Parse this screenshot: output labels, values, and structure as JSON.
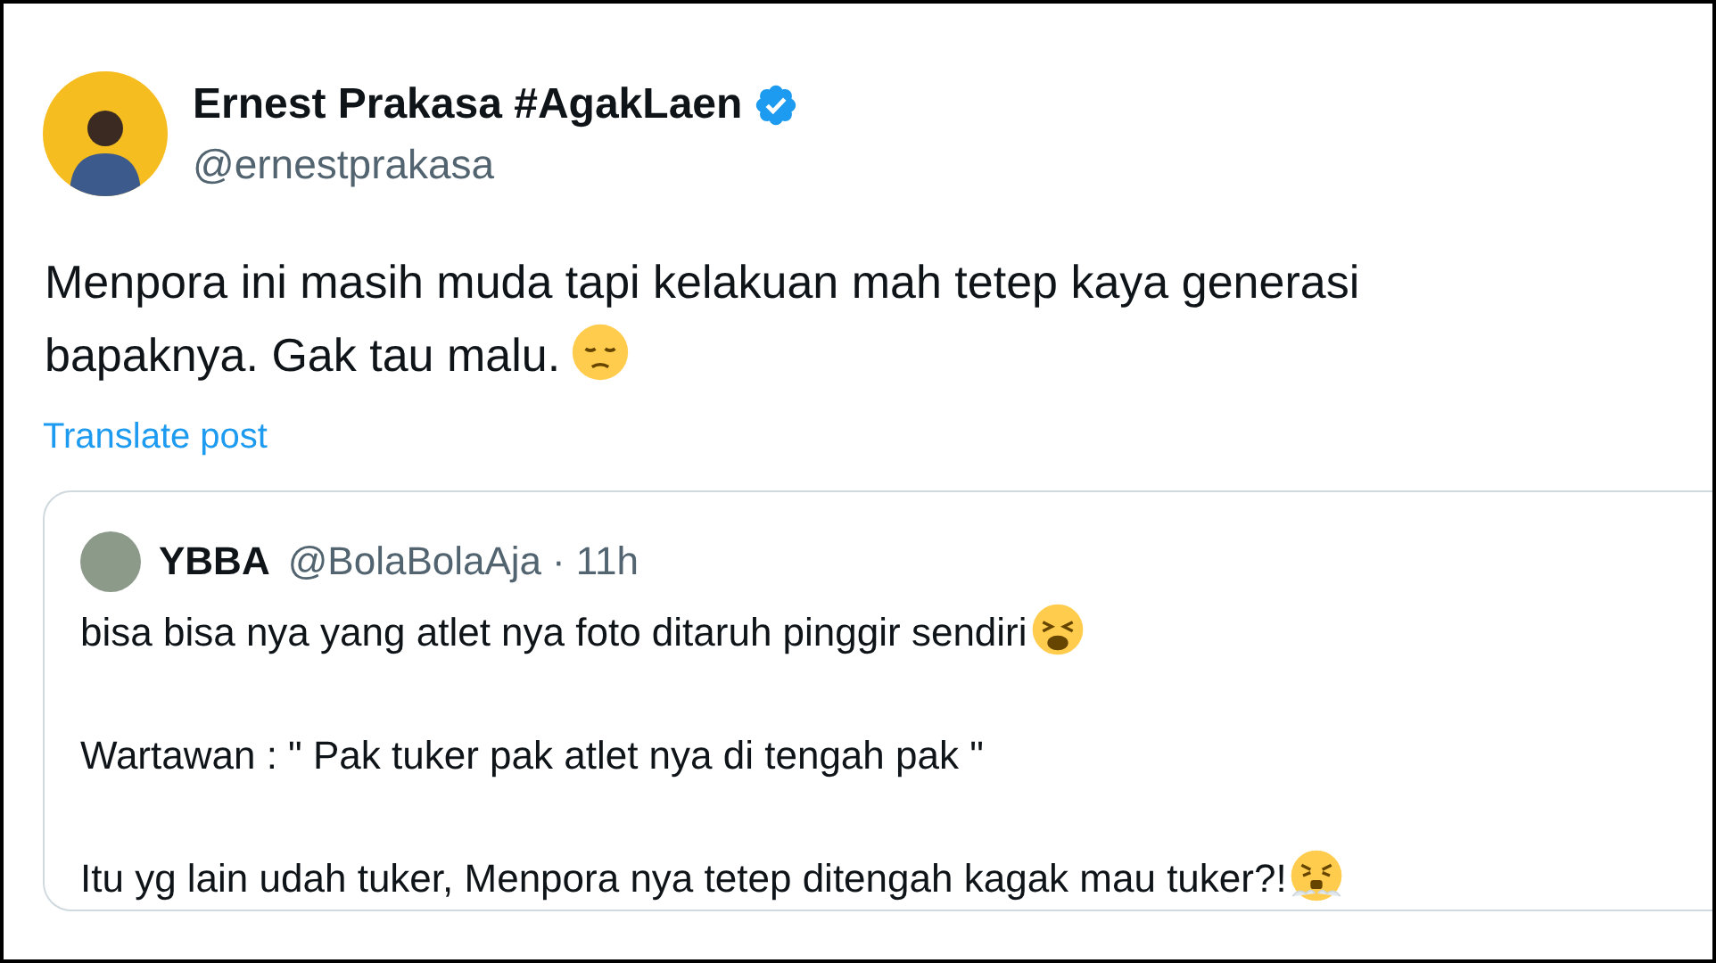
{
  "author": {
    "name": "Ernest Prakasa #AgakLaen",
    "handle": "@ernestprakasa",
    "verified": true
  },
  "text_lines": [
    "Menpora ini masih muda tapi kelakuan mah tetep kaya generasi",
    "bapaknya. Gak tau malu."
  ],
  "translate_link": "Translate post",
  "quoted_post": {
    "author_name": "YBBA",
    "handle": "@BolaBolaAja",
    "separator": "·",
    "time": "11h",
    "paragraphs": [
      "bisa bisa nya yang atlet nya foto ditaruh pinggir sendiri",
      "Wartawan : \" Pak tuker pak atlet nya di tengah pak \"",
      "Itu yg lain udah tuker, Menpora nya tetep ditengah kagak mau tuker?!"
    ]
  }
}
